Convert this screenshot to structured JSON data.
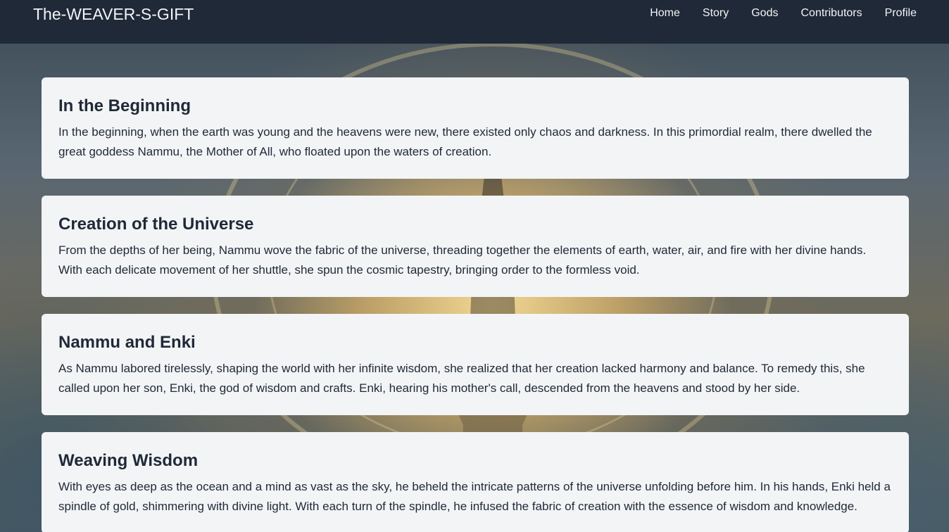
{
  "navbar": {
    "brand": "The-WEAVER-S-GIFT",
    "links": [
      "Home",
      "Story",
      "Gods",
      "Contributors",
      "Profile"
    ]
  },
  "sections": [
    {
      "title": "In the Beginning",
      "text": "In the beginning, when the earth was young and the heavens were new, there existed only chaos and darkness. In this primordial realm, there dwelled the great goddess Nammu, the Mother of All, who floated upon the waters of creation."
    },
    {
      "title": "Creation of the Universe",
      "text": "From the depths of her being, Nammu wove the fabric of the universe, threading together the elements of earth, water, air, and fire with her divine hands. With each delicate movement of her shuttle, she spun the cosmic tapestry, bringing order to the formless void."
    },
    {
      "title": "Nammu and Enki",
      "text": "As Nammu labored tirelessly, shaping the world with her infinite wisdom, she realized that her creation lacked harmony and balance. To remedy this, she called upon her son, Enki, the god of wisdom and crafts. Enki, hearing his mother's call, descended from the heavens and stood by her side."
    },
    {
      "title": "Weaving Wisdom",
      "text": "With eyes as deep as the ocean and a mind as vast as the sky, he beheld the intricate patterns of the universe unfolding before him. In his hands, Enki held a spindle of gold, shimmering with divine light. With each turn of the spindle, he infused the fabric of creation with the essence of wisdom and knowledge."
    }
  ],
  "colors": {
    "navbar_bg": "#1f2937",
    "card_bg": "#f3f4f6",
    "text": "#1f2937"
  }
}
